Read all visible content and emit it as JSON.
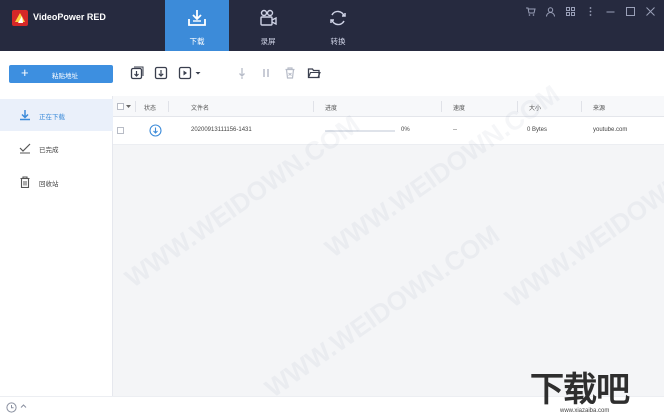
{
  "app": {
    "name": "VideoPower RED",
    "accent": "#3c8bd9",
    "titlebar_bg": "#262a3f"
  },
  "nav": {
    "tabs": [
      {
        "label": "下载",
        "icon": "download-tray-icon",
        "active": true
      },
      {
        "label": "录屏",
        "icon": "video-camera-icon",
        "active": false
      },
      {
        "label": "转换",
        "icon": "convert-arrows-icon",
        "active": false
      }
    ]
  },
  "window_controls": [
    "cart-icon",
    "user-icon",
    "grid-menu-icon",
    "more-icon",
    "minimize-icon",
    "maximize-icon",
    "close-icon"
  ],
  "toolbar": {
    "add_url_label": "粘贴地址",
    "icons": [
      "download-playlist-icon",
      "download-batch-icon",
      "download-options-icon",
      "dropdown-icon",
      "resume-icon",
      "pause-icon",
      "delete-icon",
      "open-folder-icon"
    ]
  },
  "sidebar": {
    "items": [
      {
        "label": "正在下载",
        "icon": "download-arrow-icon",
        "active": true
      },
      {
        "label": "已完成",
        "icon": "check-done-icon",
        "active": false
      },
      {
        "label": "回收站",
        "icon": "trash-icon",
        "active": false
      }
    ]
  },
  "table": {
    "columns": [
      "状态",
      "文件名",
      "进度",
      "速度",
      "大小",
      "来源"
    ],
    "rows": [
      {
        "status_icon": "download-circle-icon",
        "filename": "20200913111156-1431",
        "progress": 0,
        "progress_text": "0%",
        "speed": "--",
        "size": "0 Bytes",
        "source": "youtube.com"
      }
    ]
  },
  "statusbar": {
    "icons": [
      "clock-icon",
      "chevron-up-icon"
    ]
  },
  "watermark": {
    "text": "WWW.WEIDOWN.COM",
    "brand": "下载吧",
    "url": "www.xiazaiba.com"
  }
}
